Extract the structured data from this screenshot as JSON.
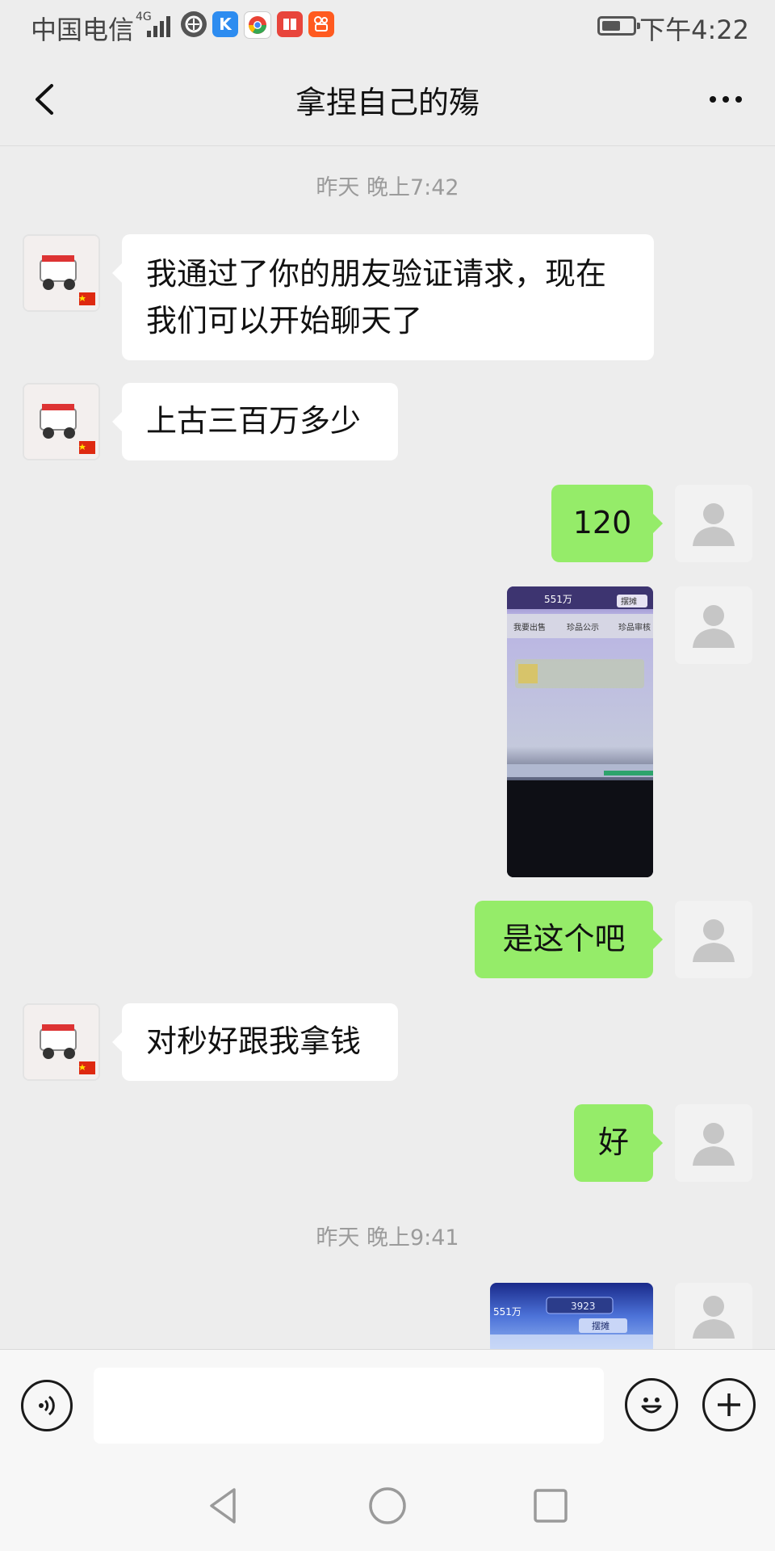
{
  "status_bar": {
    "carrier": "中国电信",
    "network": "4G",
    "app_icons": [
      "huawei-browser-icon",
      "kugou-icon",
      "chrome-icon",
      "reader-icon",
      "kuaishou-icon"
    ],
    "battery_level": 0.6,
    "time": "下午4:22"
  },
  "header": {
    "title": "拿捏自己的殤",
    "back_icon": "chevron-left-icon",
    "more_icon": "more-icon"
  },
  "messages": {
    "timestamp1": "昨天 晚上7:42",
    "m1": "我通过了你的朋友验证请求，现在我们可以开始聊天了",
    "m2": "上古三百万多少",
    "m3": "120",
    "m4_image": {
      "top_text": "551万",
      "tab_sale": "我要出售",
      "tab_public": "珍品公示",
      "tab_review": "珍品审核",
      "button": "摆摊"
    },
    "m5": "是这个吧",
    "m6": "对秒好跟我拿钱",
    "m7": "好",
    "timestamp2": "昨天 晚上9:41",
    "m8_image": {
      "left_text": "551万",
      "center_value": "3923",
      "button": "摆摊"
    }
  },
  "input_bar": {
    "voice_icon": "voice-icon",
    "emoji_icon": "emoji-icon",
    "plus_icon": "plus-icon",
    "text_value": ""
  },
  "nav_bar": {
    "icons": [
      "back-triangle-icon",
      "home-circle-icon",
      "recent-square-icon"
    ]
  },
  "colors": {
    "background": "#ededed",
    "incoming_bubble": "#ffffff",
    "outgoing_bubble": "#95ec69",
    "timestamp_text": "#9b9b9b"
  }
}
